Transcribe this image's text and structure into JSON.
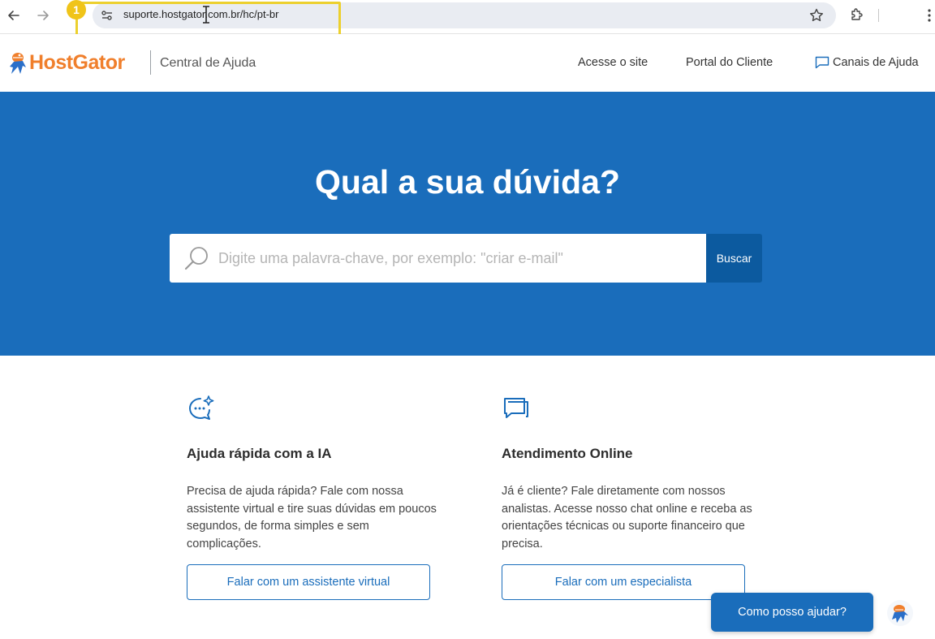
{
  "browser": {
    "url": "suporte.hostgator.com.br/hc/pt-br",
    "step_badge": "1"
  },
  "header": {
    "logo_text": "HostGator",
    "logo_subtitle": "Central de Ajuda",
    "nav": {
      "site": "Acesse o site",
      "portal": "Portal do Cliente",
      "canais": "Canais de Ajuda"
    }
  },
  "hero": {
    "title": "Qual a sua dúvida?",
    "search_placeholder": "Digite uma palavra-chave, por exemplo: \"criar e-mail\"",
    "search_button": "Buscar"
  },
  "cards": [
    {
      "title": "Ajuda rápida com a IA",
      "text": "Precisa de ajuda rápida? Fale com nossa assistente virtual e tire suas dúvidas em poucos segundos, de forma simples e sem complicações.",
      "button": "Falar com um assistente virtual"
    },
    {
      "title": "Atendimento Online",
      "text": "Já é cliente? Fale diretamente com nossos analistas. Acesse nosso chat online e receba as orientações técnicas ou suporte financeiro que precisa.",
      "button": "Falar com um especialista"
    }
  ],
  "chat": {
    "button": "Como posso ajudar?"
  },
  "colors": {
    "brand_blue": "#1a6dbb",
    "brand_orange": "#f07f2c",
    "highlight_yellow": "#ecd02e"
  }
}
